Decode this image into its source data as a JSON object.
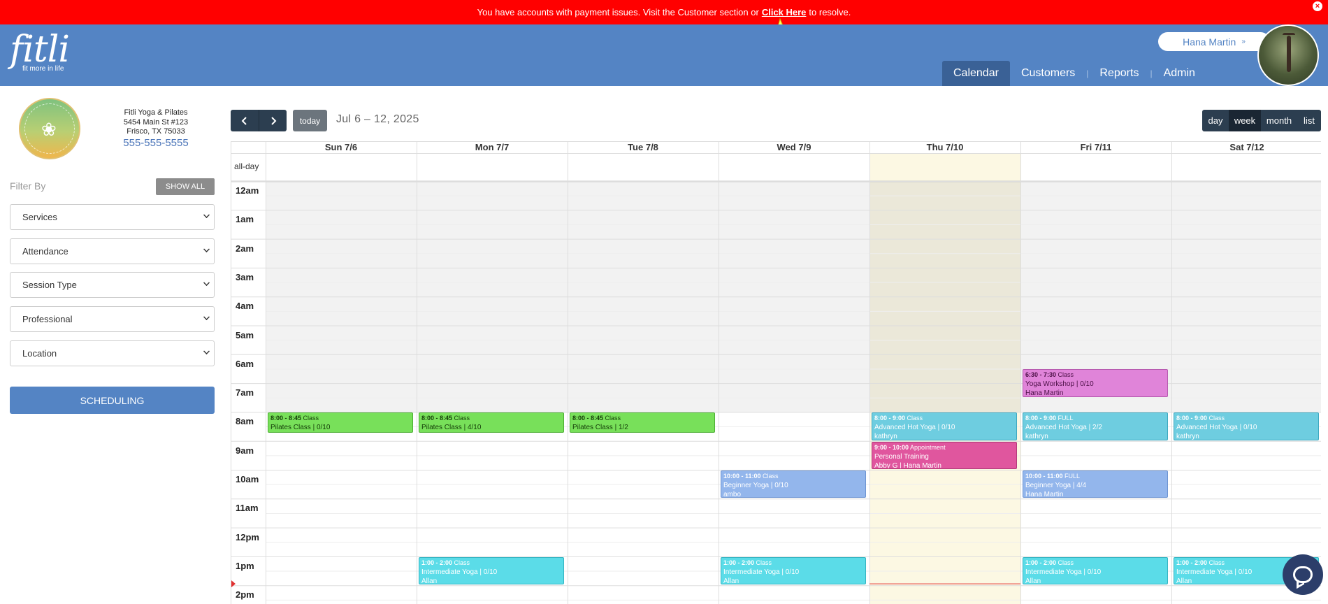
{
  "alert": {
    "text_before": "You have accounts with payment issues. Visit the Customer section or",
    "link": "Click Here",
    "text_after": "to resolve."
  },
  "header": {
    "logo_word": "fitli",
    "logo_tag": "fit more in life",
    "user_name": "Hana Martin",
    "nav": [
      "Calendar",
      "Customers",
      "Reports",
      "Admin"
    ],
    "active_nav": "Calendar"
  },
  "business": {
    "name": "Fitli Yoga & Pilates",
    "address1": "5454 Main St #123",
    "address2": "Frisco, TX 75033",
    "phone": "555-555-5555"
  },
  "sidebar": {
    "filter_label": "Filter By",
    "show_all": "SHOW ALL",
    "filters": [
      "Services",
      "Attendance",
      "Session Type",
      "Professional",
      "Location"
    ],
    "scheduling_button": "SCHEDULING"
  },
  "calendar": {
    "today_label": "today",
    "date_range": "Jul 6 – 12, 2025",
    "views": [
      "day",
      "week",
      "month",
      "list"
    ],
    "active_view": "week",
    "allday_label": "all-day",
    "days": [
      "Sun 7/6",
      "Mon 7/7",
      "Tue 7/8",
      "Wed 7/9",
      "Thu 7/10",
      "Fri 7/11",
      "Sat 7/12"
    ],
    "today_index": 4,
    "hours": [
      "12am",
      "1am",
      "2am",
      "3am",
      "4am",
      "5am",
      "6am",
      "7am",
      "8am",
      "9am",
      "10am",
      "11am",
      "12pm",
      "1pm",
      "2pm"
    ],
    "closed_until_hour": 8,
    "now_hour": 13.95,
    "events": [
      {
        "day": 0,
        "start": 8,
        "end": 8.75,
        "time": "8:00 - 8:45",
        "kind": "Class",
        "title": "Pilates Class | 0/10",
        "who": "",
        "color": "green"
      },
      {
        "day": 1,
        "start": 8,
        "end": 8.75,
        "time": "8:00 - 8:45",
        "kind": "Class",
        "title": "Pilates Class | 4/10",
        "who": "",
        "color": "green"
      },
      {
        "day": 2,
        "start": 8,
        "end": 8.75,
        "time": "8:00 - 8:45",
        "kind": "Class",
        "title": "Pilates Class | 1/2",
        "who": "",
        "color": "green"
      },
      {
        "day": 4,
        "start": 8,
        "end": 9,
        "time": "8:00 - 9:00",
        "kind": "Class",
        "title": "Advanced Hot Yoga | 0/10",
        "who": "kathryn",
        "color": "lightblue"
      },
      {
        "day": 5,
        "start": 8,
        "end": 9,
        "time": "8:00 - 9:00",
        "kind": "FULL",
        "title": "Advanced Hot Yoga | 2/2",
        "who": "kathryn",
        "color": "lightblue"
      },
      {
        "day": 6,
        "start": 8,
        "end": 9,
        "time": "8:00 - 9:00",
        "kind": "Class",
        "title": "Advanced Hot Yoga | 0/10",
        "who": "kathryn",
        "color": "lightblue"
      },
      {
        "day": 5,
        "start": 6.5,
        "end": 7.5,
        "time": "6:30 - 7:30",
        "kind": "Class",
        "title": "Yoga Workshop | 0/10",
        "who": "Hana Martin",
        "color": "pink"
      },
      {
        "day": 4,
        "start": 9,
        "end": 10,
        "time": "9:00 - 10:00",
        "kind": "Appointment",
        "title": "Personal Training",
        "who": "Abby G | Hana Martin",
        "color": "magenta"
      },
      {
        "day": 3,
        "start": 10,
        "end": 11,
        "time": "10:00 - 11:00",
        "kind": "Class",
        "title": "Beginner Yoga | 0/10",
        "who": "ambo",
        "color": "blue"
      },
      {
        "day": 5,
        "start": 10,
        "end": 11,
        "time": "10:00 - 11:00",
        "kind": "FULL",
        "title": "Beginner Yoga | 4/4",
        "who": "Hana Martin",
        "color": "blue"
      },
      {
        "day": 1,
        "start": 13,
        "end": 14,
        "time": "1:00 - 2:00",
        "kind": "Class",
        "title": "Intermediate Yoga | 0/10",
        "who": "Allan",
        "color": "cyan"
      },
      {
        "day": 3,
        "start": 13,
        "end": 14,
        "time": "1:00 - 2:00",
        "kind": "Class",
        "title": "Intermediate Yoga | 0/10",
        "who": "Allan",
        "color": "cyan"
      },
      {
        "day": 5,
        "start": 13,
        "end": 14,
        "time": "1:00 - 2:00",
        "kind": "Class",
        "title": "Intermediate Yoga | 0/10",
        "who": "Allan",
        "color": "cyan"
      },
      {
        "day": 6,
        "start": 13,
        "end": 14,
        "time": "1:00 - 2:00",
        "kind": "Class",
        "title": "Intermediate Yoga | 0/10",
        "who": "Allan",
        "color": "cyan"
      }
    ]
  },
  "colors": {
    "alert_bg": "#ff0000",
    "header_bg": "#5484c4",
    "toolbar": "#2c3e50",
    "today_col": "#fcf8e3"
  }
}
